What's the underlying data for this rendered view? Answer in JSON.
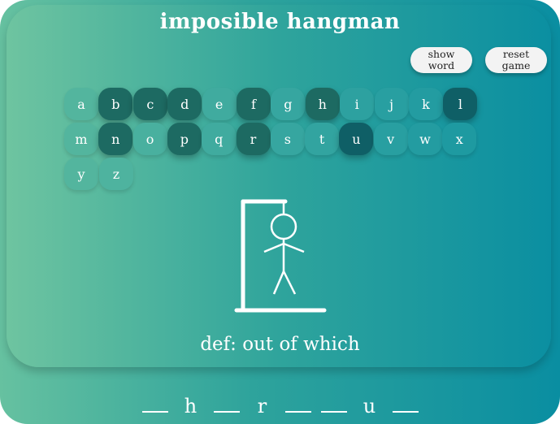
{
  "title": "imposible hangman",
  "controls": {
    "show_word": "show\nword",
    "reset_game": "reset\ngame"
  },
  "colors": {
    "key_available": "#2fa89a",
    "key_used": "#1d6a62",
    "key_used_alt": "#0f5f66",
    "text": "#ffffff"
  },
  "keyboard": [
    {
      "letter": "a",
      "used": false
    },
    {
      "letter": "b",
      "used": true
    },
    {
      "letter": "c",
      "used": true
    },
    {
      "letter": "d",
      "used": true
    },
    {
      "letter": "e",
      "used": false
    },
    {
      "letter": "f",
      "used": true
    },
    {
      "letter": "g",
      "used": false
    },
    {
      "letter": "h",
      "used": true
    },
    {
      "letter": "i",
      "used": false
    },
    {
      "letter": "j",
      "used": false
    },
    {
      "letter": "k",
      "used": false
    },
    {
      "letter": "l",
      "used": true
    },
    {
      "letter": "m",
      "used": false
    },
    {
      "letter": "n",
      "used": true
    },
    {
      "letter": "o",
      "used": false
    },
    {
      "letter": "p",
      "used": true
    },
    {
      "letter": "q",
      "used": false
    },
    {
      "letter": "r",
      "used": true
    },
    {
      "letter": "s",
      "used": false
    },
    {
      "letter": "t",
      "used": false
    },
    {
      "letter": "u",
      "used": true
    },
    {
      "letter": "v",
      "used": false
    },
    {
      "letter": "w",
      "used": false
    },
    {
      "letter": "x",
      "used": false
    },
    {
      "letter": "y",
      "used": false
    },
    {
      "letter": "z",
      "used": false
    }
  ],
  "definition": "def: out of which",
  "word_slots": [
    "",
    "h",
    "",
    "r",
    "",
    "",
    "u",
    ""
  ],
  "hangman_stage": "head-body-arms-legs"
}
